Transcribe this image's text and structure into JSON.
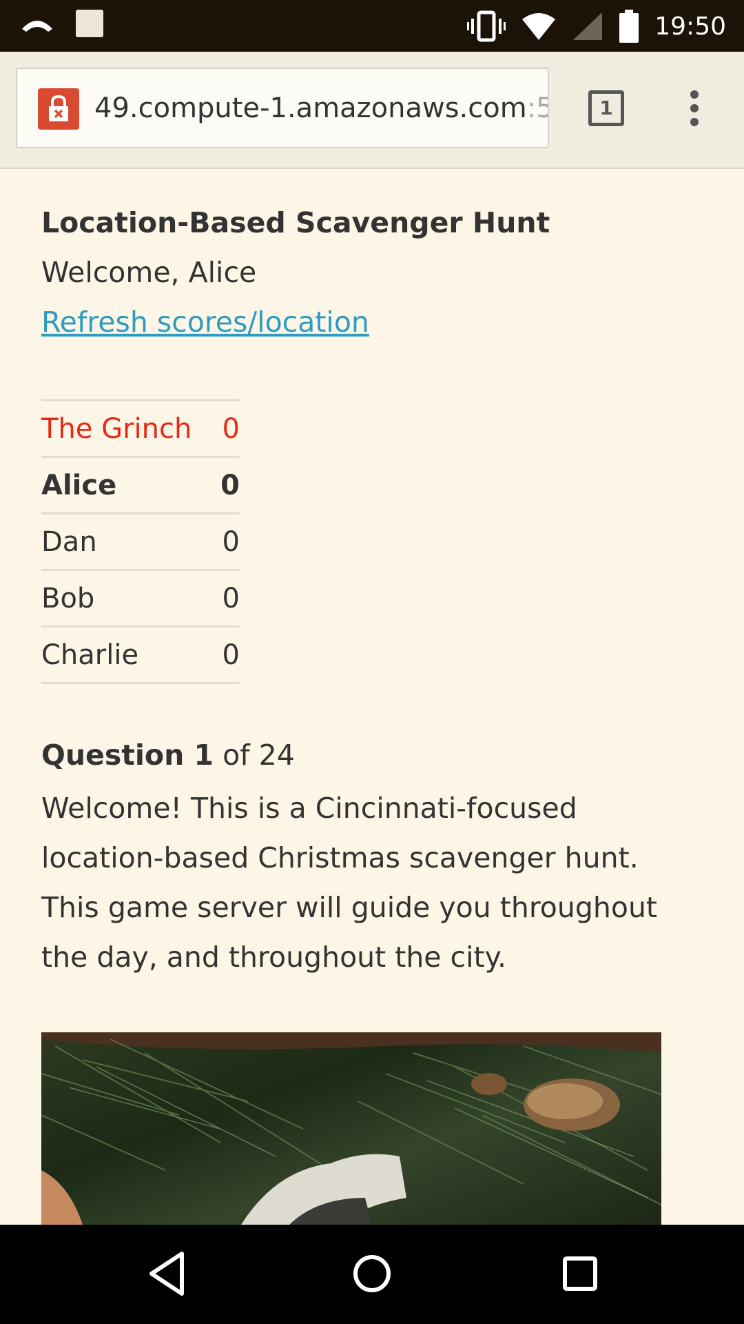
{
  "status_bar": {
    "time": "19:50",
    "icons": [
      "missed-call-icon",
      "image-notification-icon",
      "vibrate-icon",
      "wifi-icon",
      "signal-icon",
      "battery-icon"
    ]
  },
  "browser": {
    "url_main": "49.compute-1.amazonaws.com",
    "url_faded": ":5",
    "tab_count": "1"
  },
  "page": {
    "title": "Location-Based Scavenger Hunt",
    "welcome": "Welcome, Alice",
    "refresh_link": "Refresh scores/location",
    "scores": [
      {
        "name": "The Grinch",
        "score": "0"
      },
      {
        "name": "Alice",
        "score": "0"
      },
      {
        "name": "Dan",
        "score": "0"
      },
      {
        "name": "Bob",
        "score": "0"
      },
      {
        "name": "Charlie",
        "score": "0"
      }
    ],
    "question_label": "Question 1",
    "question_of": " of 24",
    "question_text": "Welcome! This is a Cincinnati-focused location-based Christmas scavenger hunt. This game server will guide you throughout the day, and throughout the city."
  },
  "colors": {
    "background": "#fdf6e6",
    "link": "#2e9bc2",
    "grinch": "#e62a1a",
    "lock": "#d94a32"
  }
}
